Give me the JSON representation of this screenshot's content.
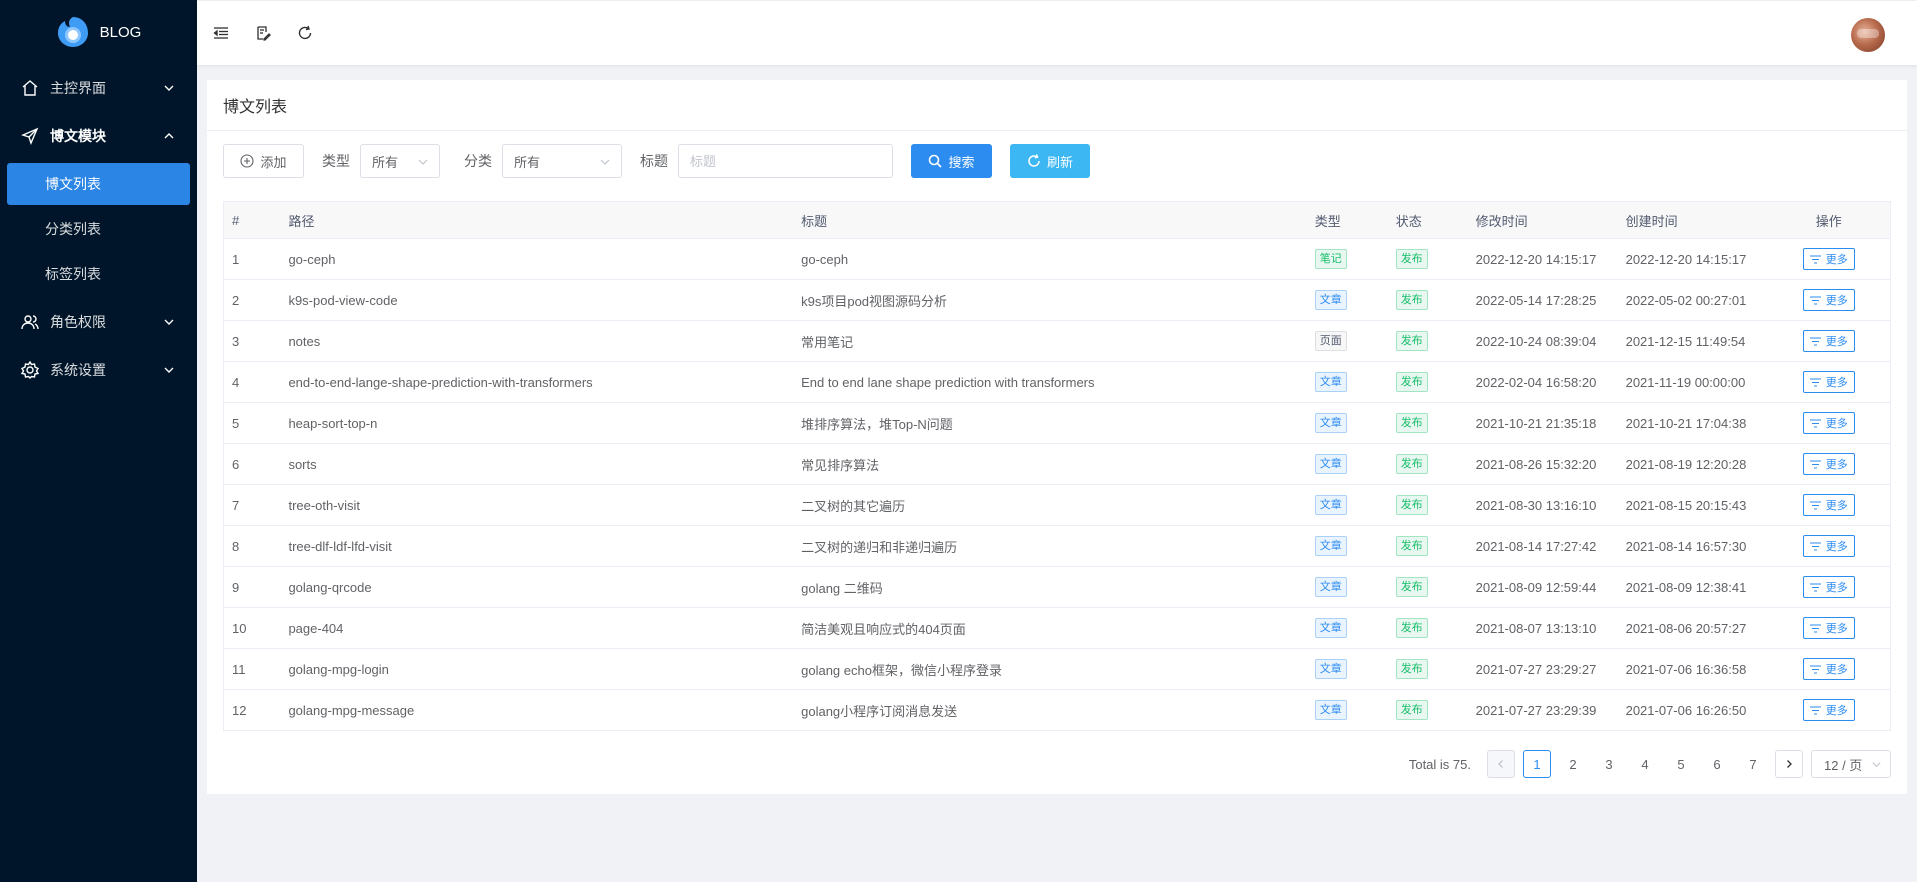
{
  "brand": {
    "name": "BLOG"
  },
  "sidebar": {
    "items": [
      {
        "label": "主控界面",
        "icon": "home-icon",
        "expanded": false
      },
      {
        "label": "博文模块",
        "icon": "send-icon",
        "expanded": true
      },
      {
        "label": "角色权限",
        "icon": "users-icon",
        "expanded": false
      },
      {
        "label": "系统设置",
        "icon": "gear-icon",
        "expanded": false
      }
    ],
    "subitems": [
      {
        "label": "博文列表",
        "active": true
      },
      {
        "label": "分类列表",
        "active": false
      },
      {
        "label": "标签列表",
        "active": false
      }
    ]
  },
  "topbar": {
    "icons": [
      "collapse-menu-icon",
      "edit-note-icon",
      "refresh-icon"
    ]
  },
  "card": {
    "title": "博文列表"
  },
  "toolbar": {
    "add_label": "添加",
    "type_label": "类型",
    "type_value": "所有",
    "category_label": "分类",
    "category_value": "所有",
    "title_label": "标题",
    "title_placeholder": "标题",
    "search_label": "搜索",
    "refresh_label": "刷新"
  },
  "table": {
    "headers": [
      "#",
      "路径",
      "标题",
      "类型",
      "状态",
      "修改时间",
      "创建时间",
      "操作"
    ],
    "more_label": "更多",
    "rows": [
      {
        "id": "1",
        "path": "go-ceph",
        "title": "go-ceph",
        "type": "笔记",
        "type_kind": "note",
        "status": "发布",
        "modified": "2022-12-20 14:15:17",
        "created": "2022-12-20 14:15:17"
      },
      {
        "id": "2",
        "path": "k9s-pod-view-code",
        "title": "k9s项目pod视图源码分析",
        "type": "文章",
        "type_kind": "article",
        "status": "发布",
        "modified": "2022-05-14 17:28:25",
        "created": "2022-05-02 00:27:01"
      },
      {
        "id": "3",
        "path": "notes",
        "title": "常用笔记",
        "type": "页面",
        "type_kind": "page",
        "status": "发布",
        "modified": "2022-10-24 08:39:04",
        "created": "2021-12-15 11:49:54"
      },
      {
        "id": "4",
        "path": "end-to-end-lange-shape-prediction-with-transformers",
        "title": "End to end lane shape prediction with transformers",
        "type": "文章",
        "type_kind": "article",
        "status": "发布",
        "modified": "2022-02-04 16:58:20",
        "created": "2021-11-19 00:00:00"
      },
      {
        "id": "5",
        "path": "heap-sort-top-n",
        "title": "堆排序算法，堆Top-N问题",
        "type": "文章",
        "type_kind": "article",
        "status": "发布",
        "modified": "2021-10-21 21:35:18",
        "created": "2021-10-21 17:04:38"
      },
      {
        "id": "6",
        "path": "sorts",
        "title": "常见排序算法",
        "type": "文章",
        "type_kind": "article",
        "status": "发布",
        "modified": "2021-08-26 15:32:20",
        "created": "2021-08-19 12:20:28"
      },
      {
        "id": "7",
        "path": "tree-oth-visit",
        "title": "二叉树的其它遍历",
        "type": "文章",
        "type_kind": "article",
        "status": "发布",
        "modified": "2021-08-30 13:16:10",
        "created": "2021-08-15 20:15:43"
      },
      {
        "id": "8",
        "path": "tree-dlf-ldf-lfd-visit",
        "title": "二叉树的递归和非递归遍历",
        "type": "文章",
        "type_kind": "article",
        "status": "发布",
        "modified": "2021-08-14 17:27:42",
        "created": "2021-08-14 16:57:30"
      },
      {
        "id": "9",
        "path": "golang-qrcode",
        "title": "golang 二维码",
        "type": "文章",
        "type_kind": "article",
        "status": "发布",
        "modified": "2021-08-09 12:59:44",
        "created": "2021-08-09 12:38:41"
      },
      {
        "id": "10",
        "path": "page-404",
        "title": "简洁美观且响应式的404页面",
        "type": "文章",
        "type_kind": "article",
        "status": "发布",
        "modified": "2021-08-07 13:13:10",
        "created": "2021-08-06 20:57:27"
      },
      {
        "id": "11",
        "path": "golang-mpg-login",
        "title": "golang echo框架，微信小程序登录",
        "type": "文章",
        "type_kind": "article",
        "status": "发布",
        "modified": "2021-07-27 23:29:27",
        "created": "2021-07-06 16:36:58"
      },
      {
        "id": "12",
        "path": "golang-mpg-message",
        "title": "golang小程序订阅消息发送",
        "type": "文章",
        "type_kind": "article",
        "status": "发布",
        "modified": "2021-07-27 23:29:39",
        "created": "2021-07-06 16:26:50"
      }
    ]
  },
  "pagination": {
    "total_text": "Total is 75.",
    "pages": [
      "1",
      "2",
      "3",
      "4",
      "5",
      "6",
      "7"
    ],
    "current": "1",
    "page_size": "12 / 页"
  },
  "colors": {
    "sidebar_bg": "#001529",
    "primary": "#2d8cf0",
    "refresh": "#3cb7f4",
    "success": "#19be6b"
  }
}
